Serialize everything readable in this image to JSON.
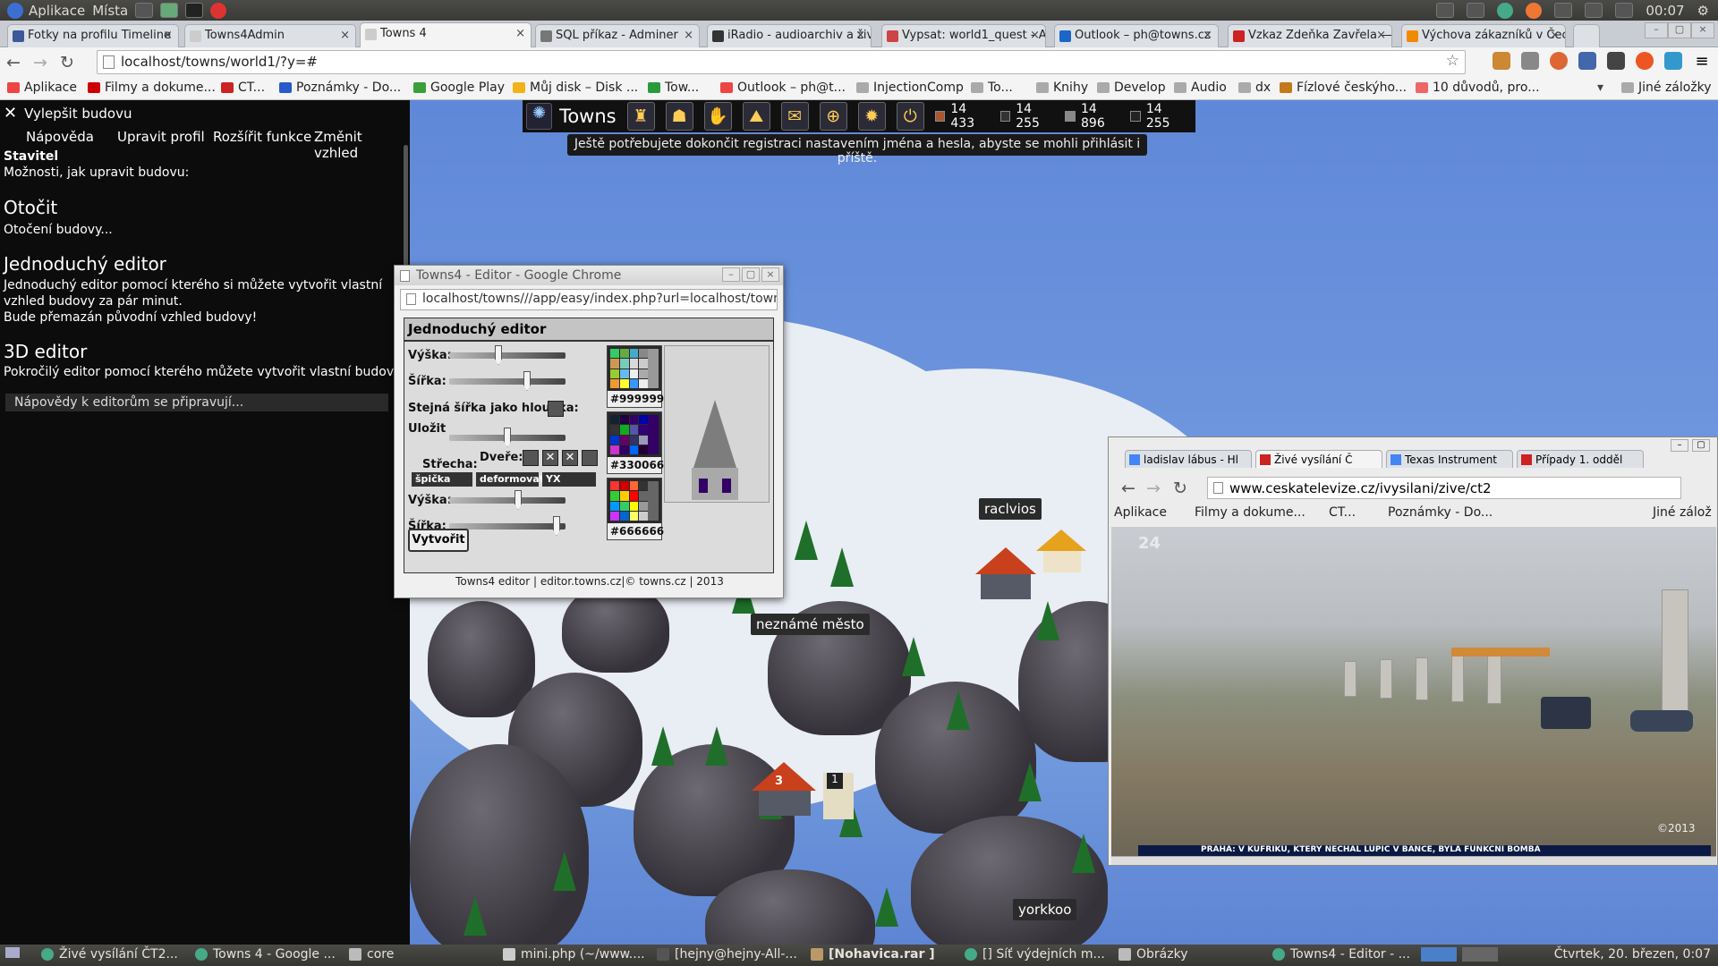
{
  "system_bar": {
    "apps_label": "Aplikace",
    "places_label": "Místa",
    "clock": "00:07"
  },
  "browser_tabs": [
    {
      "label": "Fotky na profilu Timeline",
      "color": "#3b5998"
    },
    {
      "label": "Towns4Admin",
      "color": "#cccccc"
    },
    {
      "label": "Towns 4",
      "color": "#cccccc",
      "active": true
    },
    {
      "label": "SQL příkaz - Adminer",
      "color": "#777777"
    },
    {
      "label": "iRadio - audioarchiv a živé",
      "color": "#333333"
    },
    {
      "label": "Vypsat: world1_quest - Ac",
      "color": "#cc4444"
    },
    {
      "label": "Outlook – ph@towns.cz",
      "color": "#1a66c9"
    },
    {
      "label": "Vzkaz Zdeňka Zavřela — (",
      "color": "#cc2222"
    },
    {
      "label": "Výchova zákazníků v Čech",
      "color": "#f08a00"
    }
  ],
  "address_bar": {
    "url": "localhost/towns/world1/?y=#"
  },
  "bookmarks": [
    {
      "label": "Aplikace",
      "color": "#e44"
    },
    {
      "label": "Filmy a dokume...",
      "color": "#c00"
    },
    {
      "label": "CT...",
      "color": "#c22"
    },
    {
      "label": "Poznámky - Do...",
      "color": "#2a5ac9"
    },
    {
      "label": "Google Play",
      "color": "#3a9f3a"
    },
    {
      "label": "Můj disk – Disk ...",
      "color": "#f2b31a"
    },
    {
      "label": "Tow...",
      "color": "#2a9a3a"
    },
    {
      "label": "Outlook – ph@t...",
      "color": "#e44"
    },
    {
      "label": "InjectionComp",
      "color": "#999"
    },
    {
      "label": "To...",
      "color": "#999"
    },
    {
      "label": "Knihy",
      "color": "#999"
    },
    {
      "label": "Develop",
      "color": "#999"
    },
    {
      "label": "Audio",
      "color": "#999"
    },
    {
      "label": "dx",
      "color": "#999"
    },
    {
      "label": "Fízlové českýho...",
      "color": "#c47a1a"
    },
    {
      "label": "10 důvodů, pro...",
      "color": "#e66"
    }
  ],
  "other_bookmarks": "Jiné záložky",
  "panel": {
    "header": "Vylepšit budovu",
    "menu": [
      "Nápověda",
      "Upravit profil",
      "Rozšířit funkce",
      "Změnit vzhled"
    ],
    "builder_title": "Stavitel",
    "builder_text": "Možnosti, jak upravit budovu:",
    "rotate_title": "Otočit",
    "rotate_text": "Otočení budovy...",
    "simple_title": "Jednoduchý editor",
    "simple_text1": "Jednoduchý editor pomocí kterého si můžete vytvořit vlastní",
    "simple_text2": "vzhled budovy za pár minut.",
    "simple_text3": "Bude přemazán původní vzhled budovy!",
    "editor3d_title": "3D editor",
    "editor3d_text": "Pokročilý editor pomocí kterého můžete vytvořit vlastní budovu.",
    "note": "Nápovědy k editorům se připravují..."
  },
  "hud": {
    "title": "Towns",
    "resources": [
      "14 433",
      "14 255",
      "14 896",
      "14 255"
    ],
    "icons": [
      "buildings-icon",
      "character-icon",
      "quest-icon",
      "terrain-icon",
      "chat-icon",
      "map-icon",
      "settings-icon",
      "power-icon"
    ]
  },
  "registration_note": "Ještě potřebujete dokončit registraci nastavením jména a hesla, abyste se mohli přihlásit i příště.",
  "map_labels": {
    "city1": "raclvios",
    "city2": "neznámé město",
    "city3": "yorkkoo",
    "badge1": "3",
    "badge2": "1"
  },
  "editor_window": {
    "title": "Towns4 - Editor - Google Chrome",
    "url": "localhost/towns///app/easy/index.php?url=localhost/towns",
    "pane_title": "Jednoduchý editor",
    "height_label": "Výška:",
    "width_label": "Šířka:",
    "same_label": "Stejná šířka jako hloubka:",
    "save_label": "Uložit",
    "doors_label": "Dveře:",
    "roof_label": "Střecha:",
    "roof_buttons": [
      "špička",
      "deformovat",
      "YX"
    ],
    "roof_height_label": "Výška:",
    "roof_width_label": "Šířka:",
    "color1": "#999999",
    "color2": "#330066",
    "color3": "#666666",
    "create_button": "Vytvořit",
    "footer": "Towns4 editor | editor.towns.cz|© towns.cz | 2013",
    "sliders": {
      "height": 0.42,
      "width": 0.68,
      "save": 0.5,
      "roof_height": 0.6,
      "roof_width": 0.95
    }
  },
  "video_window": {
    "tabs": [
      "ladislav lábus - Hl",
      "Živé vysílání Č",
      "Texas Instrument",
      "Případy 1. odděl"
    ],
    "url": "www.ceskatelevize.cz/ivysilani/zive/ct2",
    "bookmarks": [
      "Aplikace",
      "Filmy a dokume...",
      "CT...",
      "Poznámky - Do..."
    ],
    "other_bookmarks": "Jiné zálož",
    "channel": "24",
    "ticker": "PRAHA: V KUFŘÍKU, KTERÝ NECHAL LUPIČ V BANCE, BYLA FUNKČNÍ BOMBA",
    "copyright": "©2013"
  },
  "taskbar": {
    "items": [
      "Živé vysílání ČT2...",
      "Towns 4 - Google ...",
      "core",
      "mini.php (~/www....",
      "[hejny@hejny-All-...",
      "[Nohavica.rar ]",
      "[] Síť výdejních m...",
      "Obrázky",
      "Towns4 - Editor - ..."
    ],
    "datetime": "Čtvrtek, 20. březen, 0:07"
  }
}
